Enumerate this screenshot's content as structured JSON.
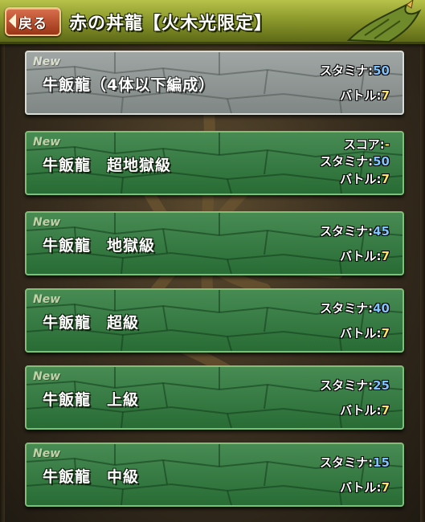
{
  "header": {
    "back_label": "戻る",
    "title": "赤の丼龍【火木光限定】"
  },
  "colors": {
    "header_green": "#8d9a2c",
    "row_green": "#2e7b3c",
    "row_gray": "#8e9694",
    "value_blue": "#7fc3ff",
    "value_yellow": "#ffe566",
    "back_button": "#9a3516"
  },
  "dungeons": [
    {
      "badge": "New",
      "name": "牛飯龍（4体以下編成）",
      "style": "gray",
      "score_label": "",
      "score_value": "",
      "stamina_label": "スタミナ:",
      "stamina_value": "50",
      "battle_label": "バトル:",
      "battle_value": "7"
    },
    {
      "badge": "New",
      "name": "牛飯龍　超地獄級",
      "style": "green",
      "score_label": "スコア:",
      "score_value": "-",
      "stamina_label": "スタミナ:",
      "stamina_value": "50",
      "battle_label": "バトル:",
      "battle_value": "7"
    },
    {
      "badge": "New",
      "name": "牛飯龍　地獄級",
      "style": "green",
      "score_label": "",
      "score_value": "",
      "stamina_label": "スタミナ:",
      "stamina_value": "45",
      "battle_label": "バトル:",
      "battle_value": "7"
    },
    {
      "badge": "New",
      "name": "牛飯龍　超級",
      "style": "green",
      "score_label": "",
      "score_value": "",
      "stamina_label": "スタミナ:",
      "stamina_value": "40",
      "battle_label": "バトル:",
      "battle_value": "7"
    },
    {
      "badge": "New",
      "name": "牛飯龍　上級",
      "style": "green",
      "score_label": "",
      "score_value": "",
      "stamina_label": "スタミナ:",
      "stamina_value": "25",
      "battle_label": "バトル:",
      "battle_value": "7"
    },
    {
      "badge": "New",
      "name": "牛飯龍　中級",
      "style": "green",
      "score_label": "",
      "score_value": "",
      "stamina_label": "スタミナ:",
      "stamina_value": "15",
      "battle_label": "バトル:",
      "battle_value": "7"
    }
  ]
}
